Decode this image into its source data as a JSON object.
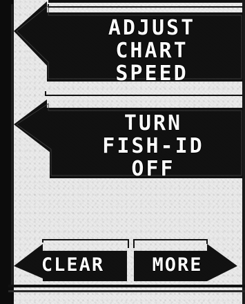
{
  "menu": {
    "adjust_chart_speed": {
      "line1": "ADJUST",
      "line2": "CHART",
      "line3": "SPEED"
    },
    "turn_fish_id_off": {
      "line1": "TURN",
      "line2": "FISH-ID",
      "line3": "OFF"
    }
  },
  "softkeys": {
    "clear_label": "CLEAR",
    "more_label": "MORE"
  },
  "colors": {
    "button_fill": "#111111",
    "button_text": "#ffffff",
    "background": "#eaeaea"
  },
  "icons": {
    "left_pointer": "left-arrow-icon",
    "right_pointer": "right-arrow-icon"
  }
}
